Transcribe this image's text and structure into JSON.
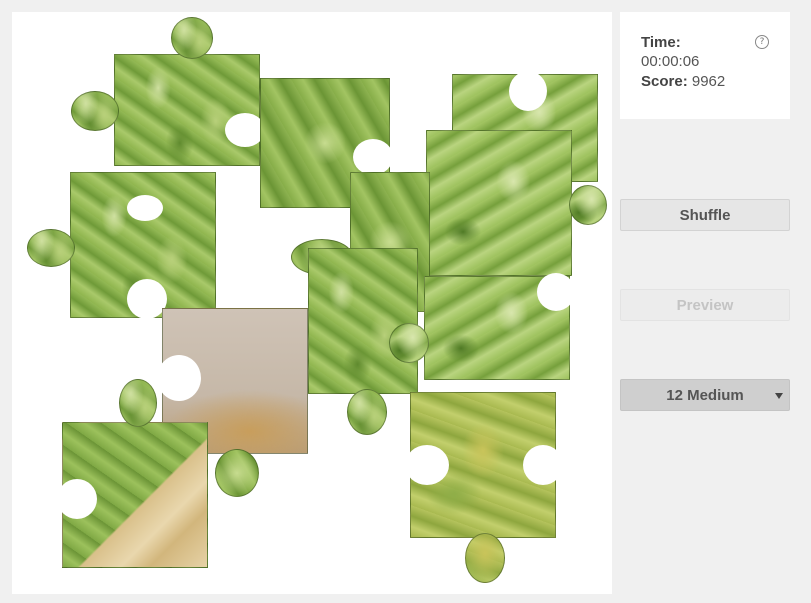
{
  "stats": {
    "time_label": "Time:",
    "time_value": "00:00:06",
    "score_label": "Score:",
    "score_value": "9962",
    "help_icon": "?"
  },
  "controls": {
    "shuffle_label": "Shuffle",
    "preview_label": "Preview",
    "difficulty_label": "12 Medium"
  },
  "puzzle": {
    "piece_count": 12,
    "image_subject": "artichokes"
  }
}
